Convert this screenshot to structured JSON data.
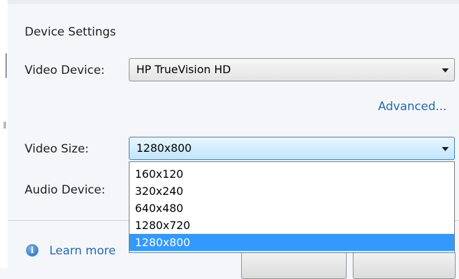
{
  "section_title": "Device Settings",
  "video_device": {
    "label": "Video Device:",
    "selected": "HP TrueVision HD"
  },
  "advanced_link": "Advanced...",
  "video_size": {
    "label": "Video Size:",
    "selected": "1280x800",
    "options": [
      "160x120",
      "320x240",
      "640x480",
      "1280x720",
      "1280x800"
    ],
    "highlighted_option": "1280x800"
  },
  "audio_device": {
    "label": "Audio Device:"
  },
  "footer": {
    "info_icon": "info-icon",
    "learn_more_text": "Learn more"
  },
  "colors": {
    "link": "#1f6bb0",
    "selection": "#3399ff",
    "active_combo_border": "#3c7fb1"
  }
}
